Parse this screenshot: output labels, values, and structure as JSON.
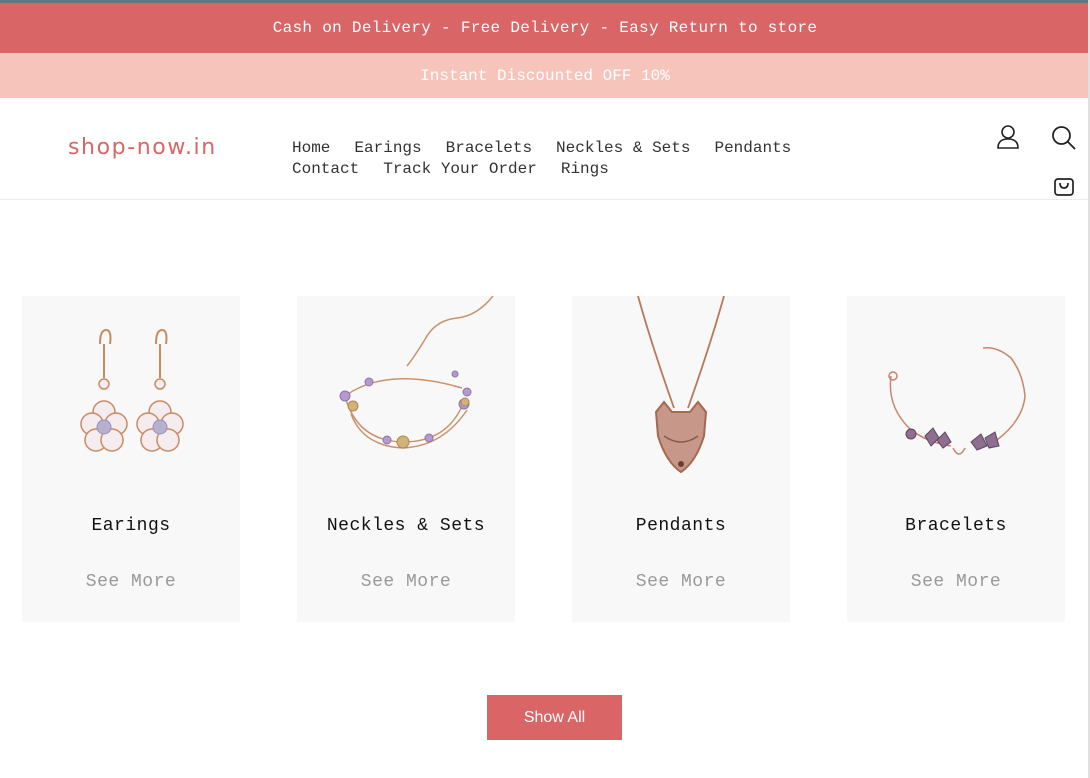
{
  "banners": {
    "primary": "Cash on Delivery - Free Delivery - Easy Return to store",
    "secondary": "Instant Discounted OFF 10%"
  },
  "header": {
    "logo": "shop-now.in",
    "nav": [
      "Home",
      "Earings",
      "Bracelets",
      "Neckles & Sets",
      "Pendants",
      "Contact",
      "Track Your Order",
      "Rings"
    ],
    "icons": [
      "user-icon",
      "search-icon",
      "shopping-bag-icon"
    ]
  },
  "categories": [
    {
      "title": "Earings",
      "link": "See More",
      "icon": "earrings-image"
    },
    {
      "title": "Neckles & Sets",
      "link": "See More",
      "icon": "bracelet-set-image"
    },
    {
      "title": "Pendants",
      "link": "See More",
      "icon": "fox-pendant-image"
    },
    {
      "title": "Bracelets",
      "link": "See More",
      "icon": "bracelet-image"
    }
  ],
  "show_all": "Show All",
  "colors": {
    "accent": "#d96566",
    "banner_light": "#f6c4bb",
    "card_bg": "#f8f8f8"
  }
}
